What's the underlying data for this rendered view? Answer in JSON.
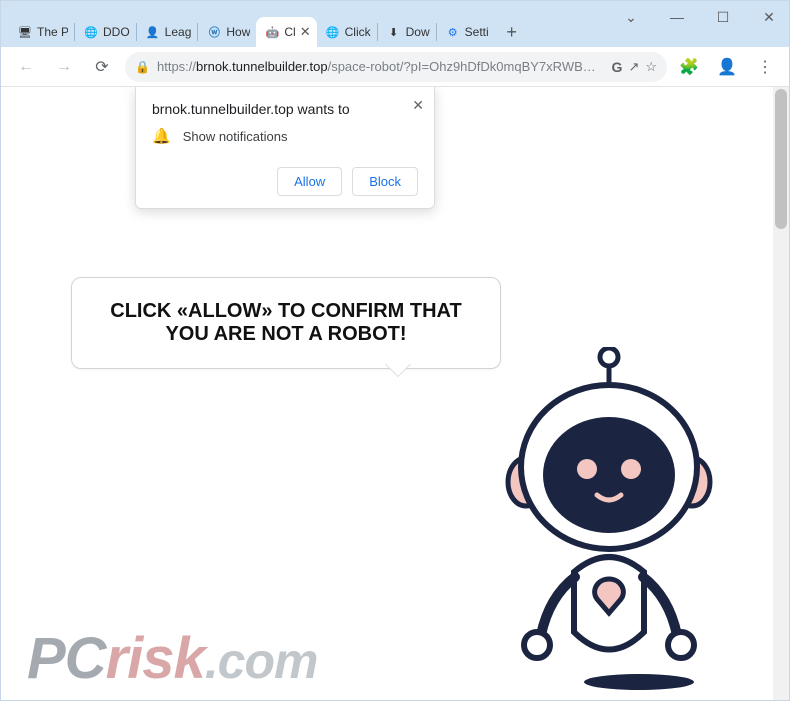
{
  "window": {
    "minimize": "—",
    "maximize": "☐",
    "close": "✕",
    "dropdown": "⌄"
  },
  "tabs": [
    {
      "label": "The P",
      "favicon": "🖥"
    },
    {
      "label": "DDO",
      "favicon": "🌐"
    },
    {
      "label": "Leag",
      "favicon": "👤"
    },
    {
      "label": "How",
      "favicon": "ⓦ"
    },
    {
      "label": "Cl",
      "favicon": "🤖",
      "active": true
    },
    {
      "label": "Click",
      "favicon": "🌐"
    },
    {
      "label": "Dow",
      "favicon": "⬇"
    },
    {
      "label": "Setti",
      "favicon": "⚙"
    }
  ],
  "nav": {
    "back": "←",
    "forward": "→",
    "reload": "⟳"
  },
  "url": {
    "proto": "https://",
    "host": "brnok.tunnelbuilder.top",
    "path": "/space-robot/?pI=Ohz9hDfDk0mqBY7xRWB…"
  },
  "toolbar": {
    "google": "G",
    "share": "↗",
    "star": "☆",
    "puzzle": "🧩",
    "account": "👤",
    "menu": "⋮"
  },
  "permission": {
    "title": "brnok.tunnelbuilder.top wants to",
    "line": "Show notifications",
    "allow": "Allow",
    "block": "Block",
    "close": "✕"
  },
  "page": {
    "speech": "CLICK «ALLOW» TO CONFIRM THAT YOU ARE NOT A ROBOT!"
  },
  "watermark": {
    "pc": "PC",
    "risk": "risk",
    "com": ".com"
  }
}
